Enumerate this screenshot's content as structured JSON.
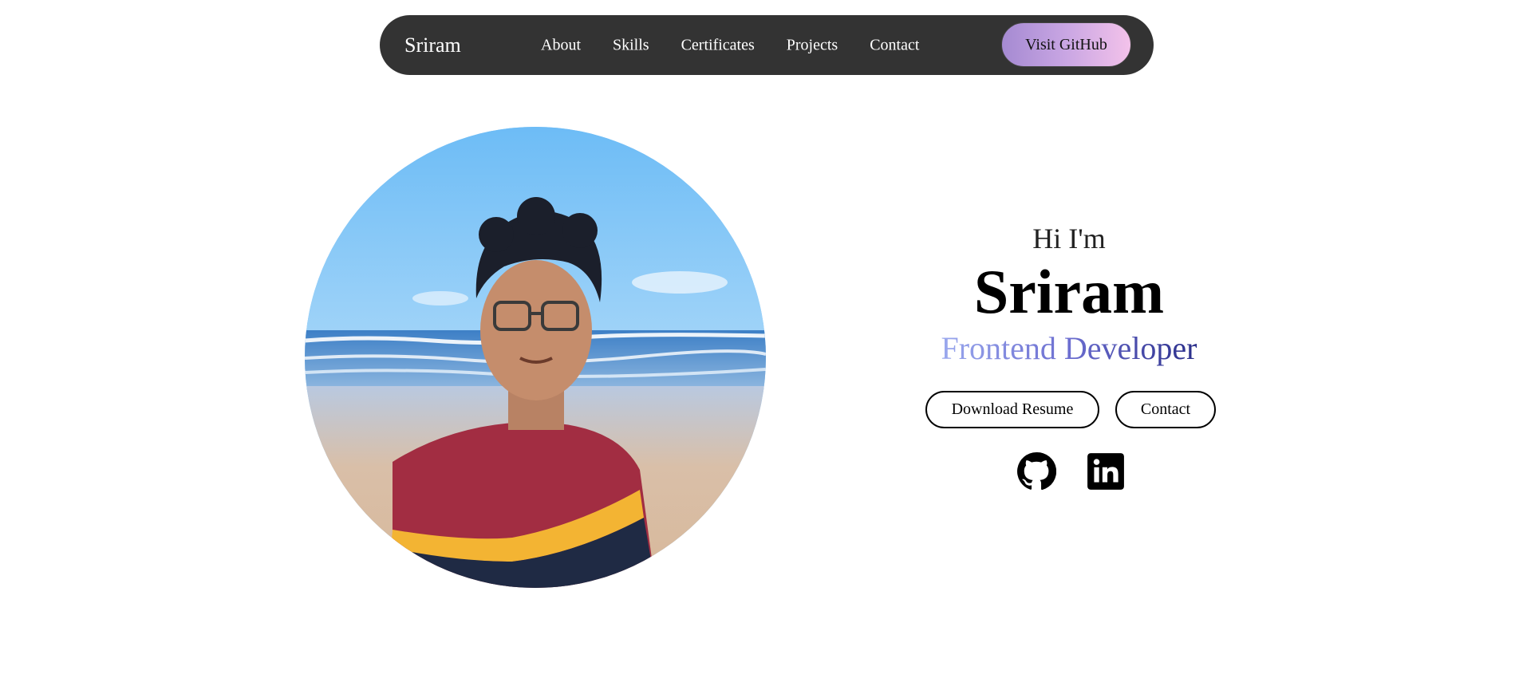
{
  "nav": {
    "brand": "Sriram",
    "links": [
      "About",
      "Skills",
      "Certificates",
      "Projects",
      "Contact"
    ],
    "cta_label": "Visit GitHub"
  },
  "hero": {
    "greeting": "Hi I'm",
    "name": "Sriram",
    "role": "Frontend Developer",
    "buttons": {
      "resume": "Download Resume",
      "contact": "Contact"
    },
    "socials": [
      "github-icon",
      "linkedin-icon"
    ],
    "portrait": "profile-photo"
  },
  "colors": {
    "nav_bg": "#333333",
    "cta_gradient_start": "#a58ad2",
    "cta_gradient_end": "#f3c2ea",
    "role_gradient_start": "#9aa8ee",
    "role_gradient_end": "#2a2e8a"
  }
}
